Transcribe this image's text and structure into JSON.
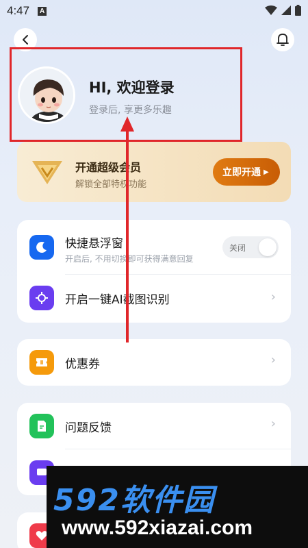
{
  "status_bar": {
    "time": "4:47",
    "notif_badge": "A"
  },
  "header": {
    "back_icon": "chevron-left-icon",
    "bell_icon": "bell-icon"
  },
  "profile": {
    "greeting": "HI, 欢迎登录",
    "subtitle": "登录后, 享更多乐趣"
  },
  "vip": {
    "title": "开通超级会员",
    "subtitle": "解锁全部特权功能",
    "button": "立即开通"
  },
  "features": [
    {
      "label": "快捷悬浮窗",
      "sub": "开启后, 不用切换即可获得满意回复",
      "toggle": "关闭",
      "color": "#1668f0"
    },
    {
      "label": "开启一键AI截图识别",
      "color": "#6a3df0"
    }
  ],
  "coupon": {
    "label": "优惠券",
    "color": "#f59a0b"
  },
  "feedback": {
    "label": "问题反馈",
    "color": "#22c25a"
  },
  "watermark": {
    "logo": "592软件园",
    "url": "www.592xiazai.com"
  }
}
